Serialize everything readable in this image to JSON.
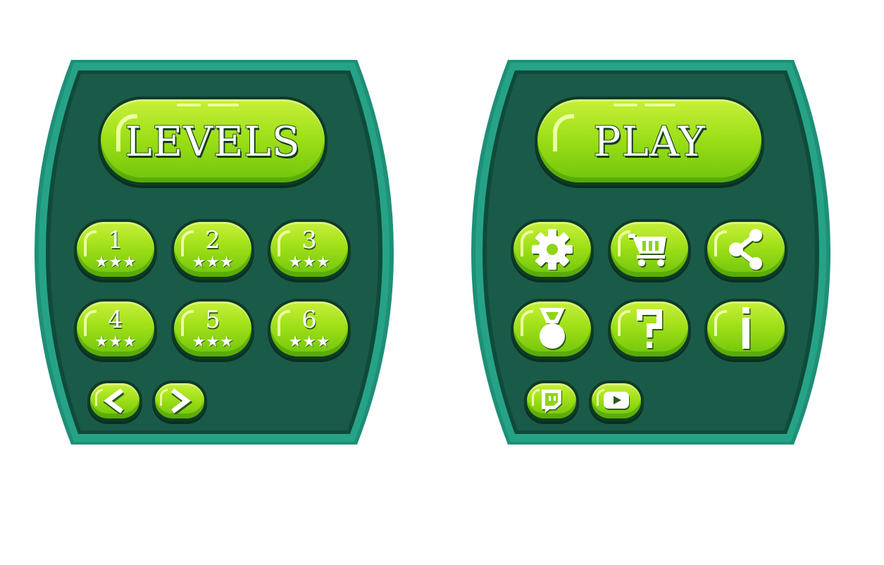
{
  "levels_panel": {
    "title": "LEVELS",
    "levels": [
      {
        "number": "1",
        "stars": "★★★"
      },
      {
        "number": "2",
        "stars": "★★★"
      },
      {
        "number": "3",
        "stars": "★★★"
      },
      {
        "number": "4",
        "stars": "★★★"
      },
      {
        "number": "5",
        "stars": "★★★"
      },
      {
        "number": "6",
        "stars": "★★★"
      }
    ],
    "nav_icons": [
      "chevron-left-icon",
      "chevron-right-icon"
    ]
  },
  "play_panel": {
    "title": "PLAY",
    "icons": [
      "gear-icon",
      "cart-icon",
      "share-icon",
      "medal-icon",
      "question-icon",
      "info-icon"
    ],
    "social_icons": [
      "twitch-icon",
      "youtube-icon"
    ]
  },
  "colors": {
    "panel_outer": "#1f8f77",
    "panel_inner": "#1a5a48",
    "button_light": "#c8f03a",
    "button_dark": "#6fc40c",
    "outline": "#0e3b26"
  }
}
